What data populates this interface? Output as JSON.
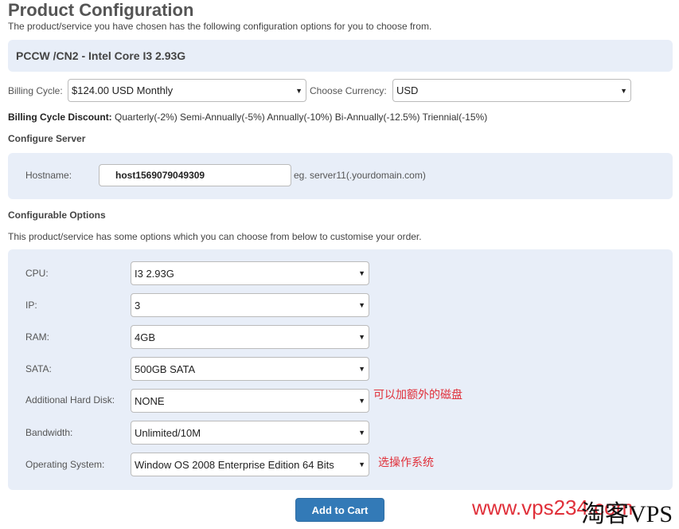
{
  "title": "Product Configuration",
  "subtitle": "The product/service you have chosen has the following configuration options for you to choose from.",
  "product_name": "PCCW /CN2 - Intel Core I3 2.93G",
  "billing": {
    "label": "Billing Cycle:",
    "value": "$124.00 USD Monthly",
    "currency_label": "Choose Currency:",
    "currency_value": "USD"
  },
  "discount": {
    "label": "Billing Cycle Discount:",
    "text": "Quarterly(-2%) Semi-Annually(-5%) Annually(-10%) Bi-Annually(-12.5%) Triennial(-15%)"
  },
  "configure_server": {
    "heading": "Configure Server",
    "hostname_label": "Hostname:",
    "hostname_value": "host1569079049309",
    "hostname_hint": "eg. server11(.yourdomain.com)"
  },
  "configurable": {
    "heading": "Configurable Options",
    "description": "This product/service has some options which you can choose from below to customise your order.",
    "options": [
      {
        "label": "CPU:",
        "value": "I3 2.93G"
      },
      {
        "label": "IP:",
        "value": "3"
      },
      {
        "label": "RAM:",
        "value": "4GB"
      },
      {
        "label": "SATA:",
        "value": "500GB SATA"
      },
      {
        "label": "Additional Hard Disk:",
        "value": "NONE",
        "note": "可以加额外的磁盘"
      },
      {
        "label": "Bandwidth:",
        "value": "Unlimited/10M"
      },
      {
        "label": "Operating System:",
        "value": "Window OS 2008 Enterprise Edition 64 Bits",
        "note": "选操作系统"
      }
    ]
  },
  "add_to_cart": "Add to Cart",
  "watermark": {
    "url": "www.vps234.com",
    "brand": "淘客VPS"
  }
}
